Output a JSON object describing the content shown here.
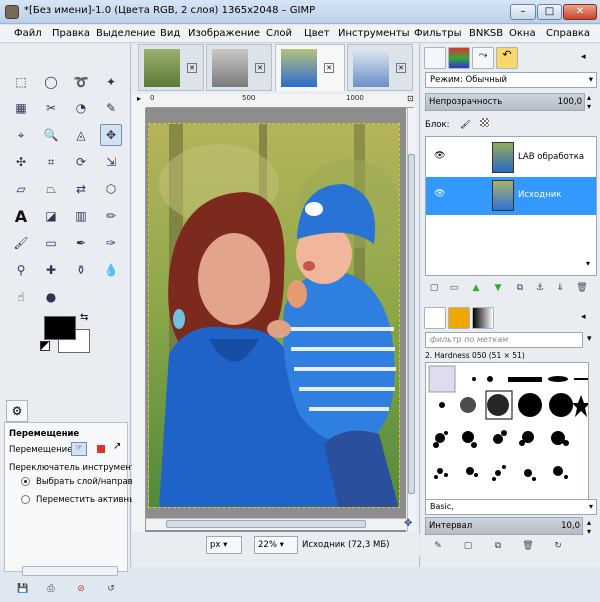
{
  "window": {
    "title": "*[Без имени]-1.0 (Цвета RGB, 2 слоя) 1365x2048 – GIMP",
    "minimize": "–",
    "maximize": "□",
    "close": "✕"
  },
  "menu": [
    "Файл",
    "Правка",
    "Выделение",
    "Вид",
    "Изображение",
    "Слой",
    "Цвет",
    "Инструменты",
    "Фильтры",
    "BNKSB",
    "Окна",
    "Справка"
  ],
  "tool_options": {
    "heading": "Перемещение",
    "move_label": "Перемещение:",
    "toggle_label": "Переключатель инструмента",
    "options": [
      {
        "label": "Выбрать слой/направ.",
        "selected": true
      },
      {
        "label": "Переместить активный",
        "selected": false
      }
    ]
  },
  "ruler": {
    "ticks": [
      "0",
      "500",
      "1000"
    ]
  },
  "status": {
    "unit": "px",
    "zoom": "22%",
    "layer_info": "Исходник (72,3 МБ)"
  },
  "layers": {
    "mode_label": "Режим: Обычный",
    "opacity_label": "Непрозрачность",
    "opacity_value": "100,0",
    "lock_label": "Блок:",
    "items": [
      {
        "name": "LAB обработка",
        "selected": false
      },
      {
        "name": "Исходник",
        "selected": true
      }
    ]
  },
  "brushes": {
    "filter_placeholder": "фильтр по меткам",
    "current": "2. Hardness 050 (51 × 51)",
    "preset": "Basic,",
    "spacing_label": "Интервал",
    "spacing_value": "10,0"
  },
  "colors": {
    "accent": "#3399ff",
    "foreground": "#000000",
    "background": "#ffffff"
  }
}
